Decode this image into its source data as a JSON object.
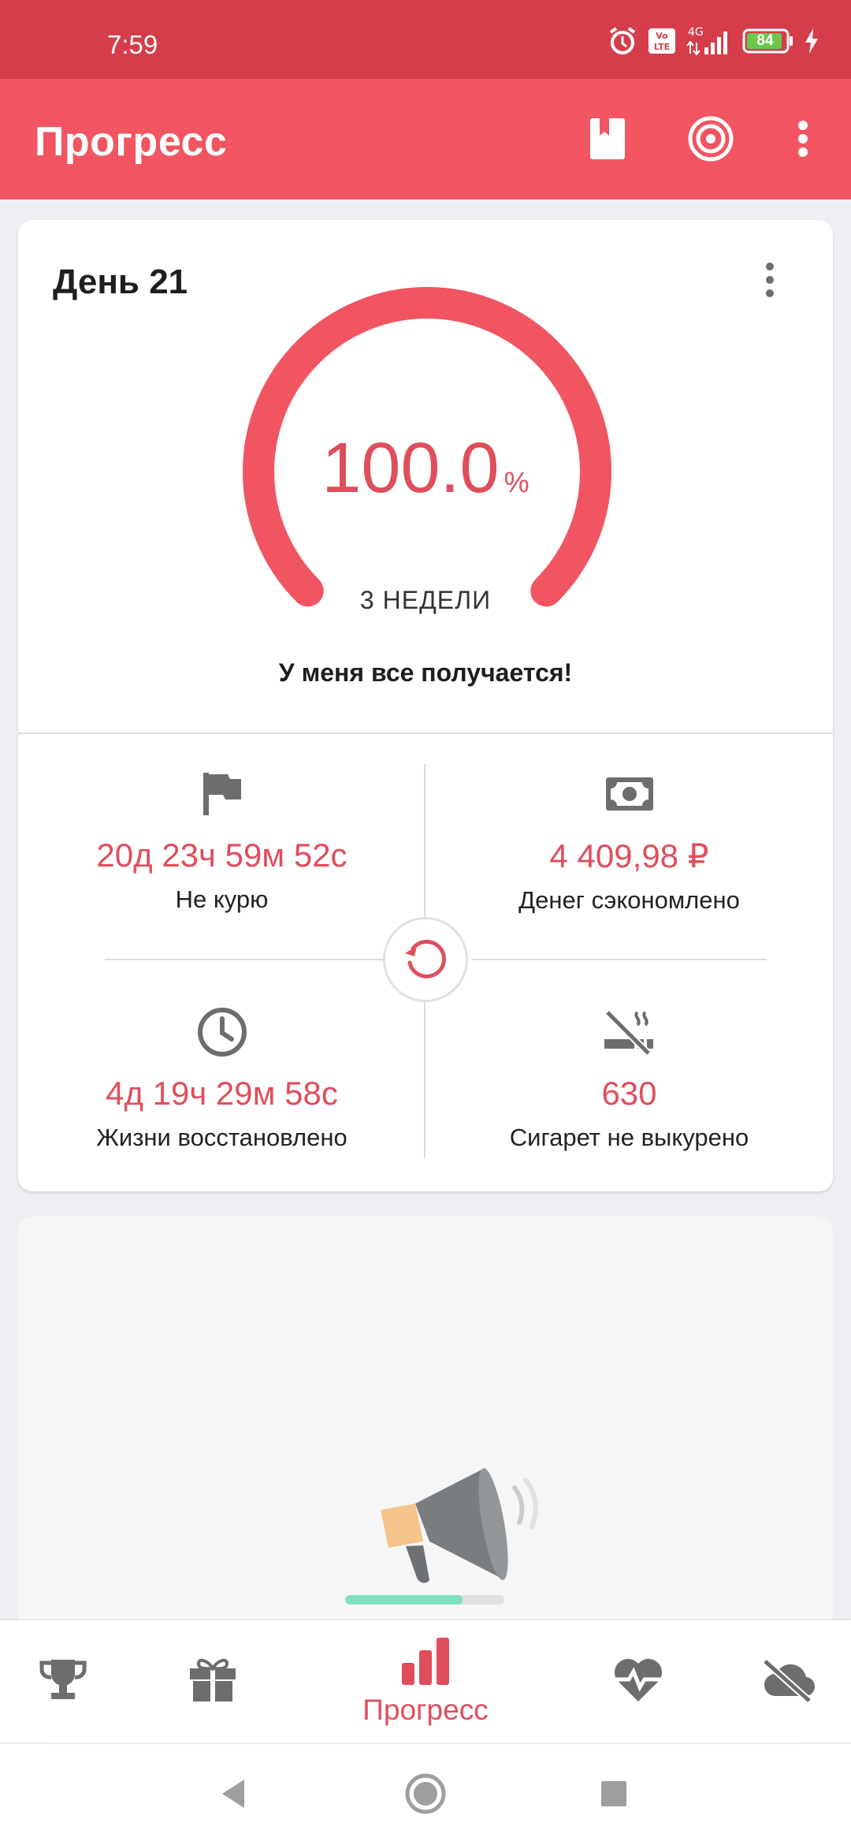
{
  "status_bar": {
    "time": "7:59",
    "network": "4G",
    "volte": "Vo LTE",
    "battery_level": "84",
    "icons": [
      "alarm-icon",
      "volte-icon",
      "signal-icon",
      "battery-icon",
      "charging-icon"
    ]
  },
  "app_bar": {
    "title": "Прогресс",
    "actions": [
      "bookmark-icon",
      "target-icon",
      "more-vert-icon"
    ]
  },
  "progress_card": {
    "day_label": "День 21",
    "gauge": {
      "value": "100.0",
      "unit": "%",
      "fraction": 1.0,
      "caption": "3 НЕДЕЛИ"
    },
    "motto": "У меня все получается!",
    "stats": [
      {
        "icon": "flag-icon",
        "value": "20д 23ч 59м 52с",
        "label": "Не курю"
      },
      {
        "icon": "money-icon",
        "value": "4 409,98 ₽",
        "label": "Денег сэкономлено"
      },
      {
        "icon": "clock-icon",
        "value": "4д 19ч 29м 58с",
        "label": "Жизни восстановлено"
      },
      {
        "icon": "no-smoking-icon",
        "value": "630",
        "label": "Сигарет не выкурено"
      }
    ],
    "reset_icon": "reset-icon"
  },
  "promo_card": {
    "icon": "megaphone-icon",
    "loading_fraction": 0.74
  },
  "bottom_nav": {
    "items": [
      {
        "icon": "trophy-icon",
        "label": ""
      },
      {
        "icon": "gift-icon",
        "label": ""
      },
      {
        "icon": "bar-chart-icon",
        "label": "Прогресс",
        "active": true
      },
      {
        "icon": "heart-pulse-icon",
        "label": ""
      },
      {
        "icon": "cloud-off-icon",
        "label": ""
      }
    ]
  },
  "system_nav": [
    "back-icon",
    "home-icon",
    "recents-icon"
  ],
  "colors": {
    "status_bar": "#d63d4a",
    "app_bar": "#f05561",
    "accent": "#e04e5c",
    "icon_gray": "#6d6d6d",
    "background": "#eeeff2"
  }
}
